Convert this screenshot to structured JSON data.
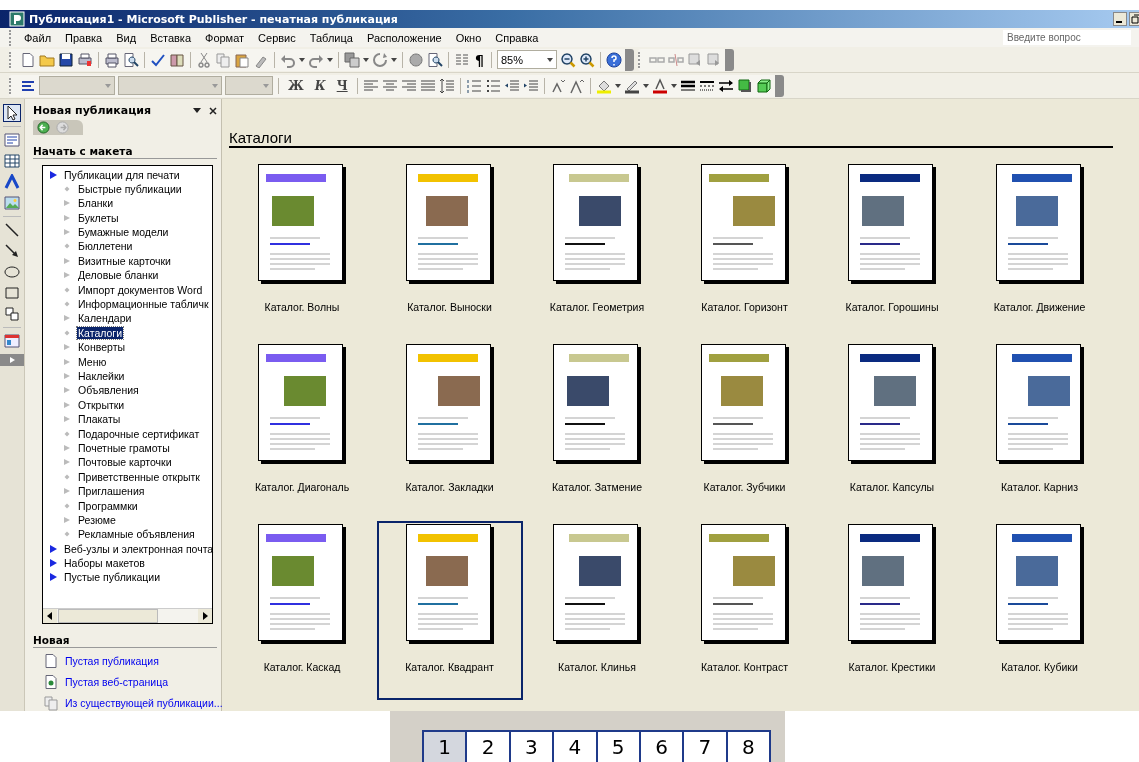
{
  "window": {
    "title": "Публикация1 - Microsoft Publisher - печатная публикация"
  },
  "menu": [
    "Файл",
    "Правка",
    "Вид",
    "Вставка",
    "Формат",
    "Сервис",
    "Таблица",
    "Расположение",
    "Окно",
    "Справка"
  ],
  "help_search": {
    "placeholder": "Введите вопрос"
  },
  "zoom": {
    "value": "85%"
  },
  "show_marks_glyph": "¶",
  "format_buttons": [
    "Ж",
    "К",
    "Ч"
  ],
  "task_pane": {
    "title": "Новая публикация",
    "section": "Начать с макета",
    "tree": [
      {
        "label": "Публикации для печати",
        "kind": "group",
        "children": [
          {
            "label": "Быстрые публикации",
            "kind": "dot",
            "selected": false
          },
          {
            "label": "Бланки",
            "kind": "arrow",
            "selected": false
          },
          {
            "label": "Буклеты",
            "kind": "arrow",
            "selected": false
          },
          {
            "label": "Бумажные модели",
            "kind": "arrow",
            "selected": false
          },
          {
            "label": "Бюллетени",
            "kind": "dot",
            "selected": false
          },
          {
            "label": "Визитные карточки",
            "kind": "arrow",
            "selected": false
          },
          {
            "label": "Деловые бланки",
            "kind": "arrow",
            "selected": false
          },
          {
            "label": "Импорт документов Word",
            "kind": "dot",
            "selected": false
          },
          {
            "label": "Информационные табличк",
            "kind": "dot",
            "selected": false
          },
          {
            "label": "Календари",
            "kind": "arrow",
            "selected": false
          },
          {
            "label": "Каталоги",
            "kind": "dot",
            "selected": true
          },
          {
            "label": "Конверты",
            "kind": "arrow",
            "selected": false
          },
          {
            "label": "Меню",
            "kind": "arrow",
            "selected": false
          },
          {
            "label": "Наклейки",
            "kind": "arrow",
            "selected": false
          },
          {
            "label": "Объявления",
            "kind": "arrow",
            "selected": false
          },
          {
            "label": "Открытки",
            "kind": "arrow",
            "selected": false
          },
          {
            "label": "Плакаты",
            "kind": "arrow",
            "selected": false
          },
          {
            "label": "Подарочные сертификат",
            "kind": "dot",
            "selected": false
          },
          {
            "label": "Почетные грамоты",
            "kind": "arrow",
            "selected": false
          },
          {
            "label": "Почтовые карточки",
            "kind": "arrow",
            "selected": false
          },
          {
            "label": "Приветственные открытк",
            "kind": "dot",
            "selected": false
          },
          {
            "label": "Приглашения",
            "kind": "arrow",
            "selected": false
          },
          {
            "label": "Программки",
            "kind": "dot",
            "selected": false
          },
          {
            "label": "Резюме",
            "kind": "arrow",
            "selected": false
          },
          {
            "label": "Рекламные объявления",
            "kind": "dot",
            "selected": false
          }
        ]
      },
      {
        "label": "Веб-узлы и электронная почта",
        "kind": "group"
      },
      {
        "label": "Наборы макетов",
        "kind": "group"
      },
      {
        "label": "Пустые публикации",
        "kind": "group"
      }
    ],
    "new_section": "Новая",
    "new_links": [
      {
        "label": "Пустая публикация",
        "kind": "blank"
      },
      {
        "label": "Пустая веб-страница",
        "kind": "web"
      },
      {
        "label": "Из существующей публикации...",
        "kind": "existing"
      }
    ]
  },
  "gallery": {
    "title": "Каталоги",
    "items": [
      {
        "label": "Каталог. Волны",
        "selected": false
      },
      {
        "label": "Каталог. Выноски",
        "selected": false
      },
      {
        "label": "Каталог. Геометрия",
        "selected": false
      },
      {
        "label": "Каталог. Горизонт",
        "selected": false
      },
      {
        "label": "Каталог. Горошины",
        "selected": false
      },
      {
        "label": "Каталог. Движение",
        "selected": false
      },
      {
        "label": "Каталог. Диагональ",
        "selected": false
      },
      {
        "label": "Каталог. Закладки",
        "selected": false
      },
      {
        "label": "Каталог. Затмение",
        "selected": false
      },
      {
        "label": "Каталог. Зубчики",
        "selected": false
      },
      {
        "label": "Каталог. Капсулы",
        "selected": false
      },
      {
        "label": "Каталог. Карниз",
        "selected": false
      },
      {
        "label": "Каталог. Каскад",
        "selected": false
      },
      {
        "label": "Каталог. Квадрант",
        "selected": true
      },
      {
        "label": "Каталог. Клинья",
        "selected": false
      },
      {
        "label": "Каталог. Контраст",
        "selected": false
      },
      {
        "label": "Каталог. Крестики",
        "selected": false
      },
      {
        "label": "Каталог. Кубики",
        "selected": false
      }
    ]
  },
  "page_navigator": {
    "pages": [
      {
        "label": "1",
        "selected": true
      },
      {
        "label": "2",
        "selected": false
      },
      {
        "label": "3",
        "selected": false
      },
      {
        "label": "4",
        "selected": false
      },
      {
        "label": "5",
        "selected": false
      },
      {
        "label": "6",
        "selected": false
      },
      {
        "label": "7",
        "selected": false
      },
      {
        "label": "8",
        "selected": false
      }
    ]
  }
}
